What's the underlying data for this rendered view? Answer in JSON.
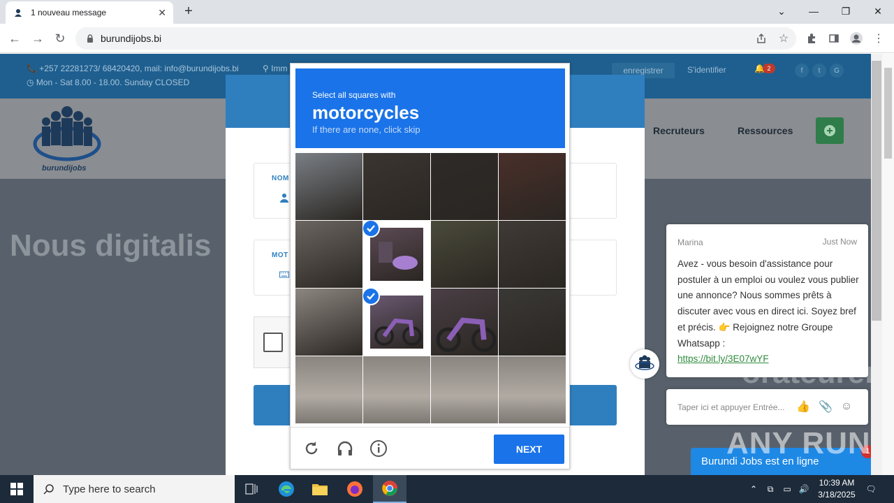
{
  "browser": {
    "tab_title": "1 nouveau message",
    "url": "burundijobs.bi"
  },
  "site": {
    "contact_line": "+257 22281273/ 68420420, mail: info@burundijobs.bi",
    "hours_line": "Mon - Sat 8.00 - 18.00. Sunday CLOSED",
    "location_partial": "Imm",
    "register_label": "enregistrer",
    "login_label": "S'identifier",
    "notif_count": "2",
    "logo_text": "burundijobs",
    "nav": {
      "recruiters": "Recruteurs",
      "resources": "Ressources"
    },
    "hero_left": "Nous digitalis",
    "hero_right": "orateurement"
  },
  "login_form": {
    "name_label": "NOM",
    "password_label": "MOT"
  },
  "captcha": {
    "instruction_small": "Select all squares with",
    "target": "motorcycles",
    "hint": "If there are none, click skip",
    "next_label": "NEXT",
    "selected_cells": [
      5,
      9
    ]
  },
  "chat": {
    "agent_name": "Marina",
    "time": "Just Now",
    "message": "Avez - vous besoin d'assistance pour postuler à un emploi ou voulez vous publier une annonce? Nous sommes prêts à discuter avec vous en direct ici. Soyez bref et précis. 👉 Rejoignez notre Groupe Whatsapp :",
    "link": "https://bit.ly/3E07wYF",
    "input_placeholder": "Taper ici et appuyer Entrée...",
    "status_banner": "Burundi Jobs est en ligne",
    "status_badge": "1"
  },
  "watermark": "ANY RUN",
  "taskbar": {
    "search_placeholder": "Type here to search",
    "time": "10:39 AM",
    "date": "3/18/2025"
  }
}
